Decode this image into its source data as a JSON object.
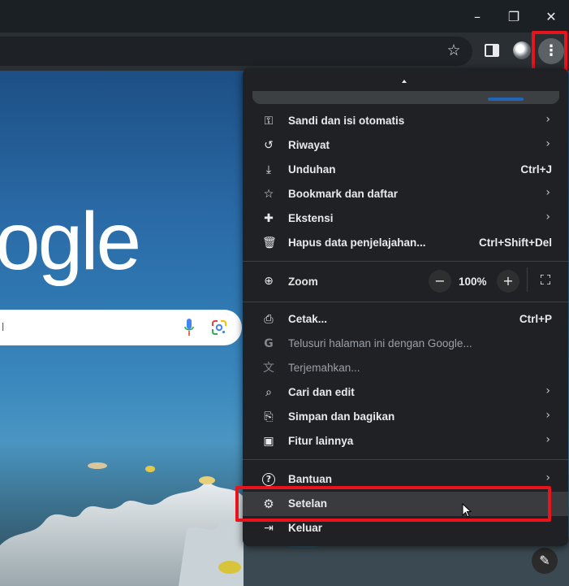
{
  "window": {
    "minimize_icon": "minimize-icon",
    "maximize_icon": "restore-icon",
    "close_icon": "close-icon",
    "minimize_glyph": "–",
    "restore_glyph": "❐",
    "close_glyph": "✕"
  },
  "toolbar": {
    "bookmark_icon": "star-icon",
    "kebab_glyph": "⋮"
  },
  "ntp": {
    "logo_text": "ogle",
    "search_text": "l",
    "edit_glyph": "✎"
  },
  "menu": {
    "items": [
      {
        "label": "Sandi dan isi otomatis",
        "icon": "key-icon",
        "glyph": "⚿",
        "arrow": "›"
      },
      {
        "label": "Riwayat",
        "icon": "history-icon",
        "glyph": "↺",
        "arrow": "›"
      },
      {
        "label": "Unduhan",
        "icon": "download-icon",
        "glyph": "⤓",
        "shortcut": "Ctrl+J"
      },
      {
        "label": "Bookmark dan daftar",
        "icon": "star-icon",
        "glyph": "☆",
        "arrow": "›"
      },
      {
        "label": "Ekstensi",
        "icon": "puzzle-icon",
        "glyph": "✚",
        "arrow": "›"
      },
      {
        "label": "Hapus data penjelajahan...",
        "icon": "trash-icon",
        "glyph": "🗑",
        "shortcut": "Ctrl+Shift+Del"
      }
    ],
    "zoom": {
      "label": "Zoom",
      "value": "100%",
      "minus": "−",
      "plus": "+",
      "icon": "zoom-icon",
      "glyph": "⊕"
    },
    "items2": [
      {
        "label": "Cetak...",
        "icon": "print-icon",
        "glyph": "⎙",
        "shortcut": "Ctrl+P"
      },
      {
        "label": "Telusuri halaman ini dengan Google...",
        "icon": "google-g-icon",
        "glyph": "G"
      },
      {
        "label": "Terjemahkan...",
        "icon": "translate-icon",
        "glyph": "文"
      },
      {
        "label": "Cari dan edit",
        "icon": "find-icon",
        "glyph": "⌕",
        "arrow": "›"
      },
      {
        "label": "Simpan dan bagikan",
        "icon": "save-share-icon",
        "glyph": "⎘",
        "arrow": "›"
      },
      {
        "label": "Fitur lainnya",
        "icon": "toolbox-icon",
        "glyph": "▣",
        "arrow": "›"
      }
    ],
    "items3": [
      {
        "label": "Bantuan",
        "icon": "help-icon",
        "glyph": "?",
        "arrow": "›"
      },
      {
        "label": "Setelan",
        "icon": "gear-icon",
        "glyph": "⚙"
      },
      {
        "label": "Keluar",
        "icon": "exit-icon",
        "glyph": "⇥"
      }
    ]
  },
  "colors": {
    "highlight": "#e8141c",
    "menu_bg": "#202124",
    "toolbar_bg": "#2a2f33"
  }
}
